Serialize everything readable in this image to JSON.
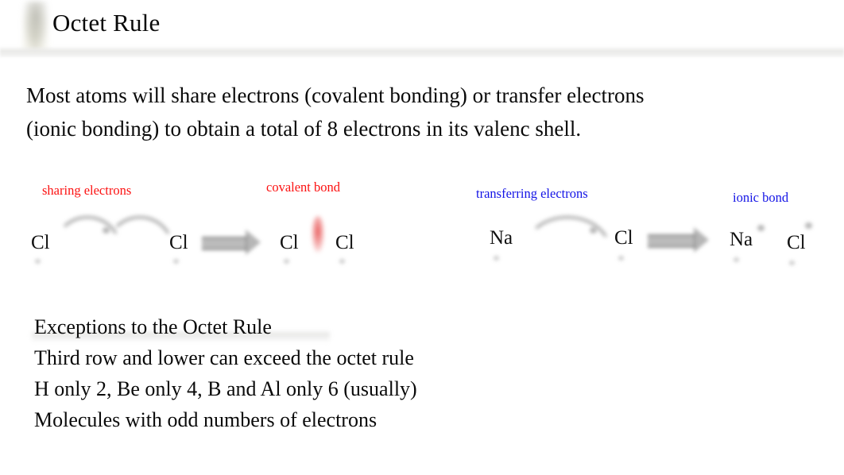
{
  "slide": {
    "title": "Octet Rule",
    "background_color": "#ffffff",
    "accent_red": "#fc1111",
    "accent_blue": "#1414e6"
  },
  "intro": {
    "line1": "Most atoms will share electrons (covalent bonding) or transfer electrons",
    "line2": "(ionic bonding) to obtain a total of 8 electrons in its valenc shell."
  },
  "diagram": {
    "covalent": {
      "label_sharing": "sharing electrons",
      "label_bond": "covalent bond",
      "reactant_left": "Cl",
      "reactant_right": "Cl",
      "product_left": "Cl",
      "product_right": "Cl"
    },
    "ionic": {
      "label_transfer": "transferring electrons",
      "label_bond": "ionic bond",
      "reactant_left": "Na",
      "reactant_right": "Cl",
      "product_left": "Na",
      "product_right": "Cl"
    }
  },
  "exceptions": {
    "heading": "Exceptions to the Octet Rule",
    "item1": "Third row and lower can exceed the octet rule",
    "item2": "H only 2, Be only 4, B and Al only 6 (usually)",
    "item3": "Molecules with odd numbers of electrons"
  }
}
